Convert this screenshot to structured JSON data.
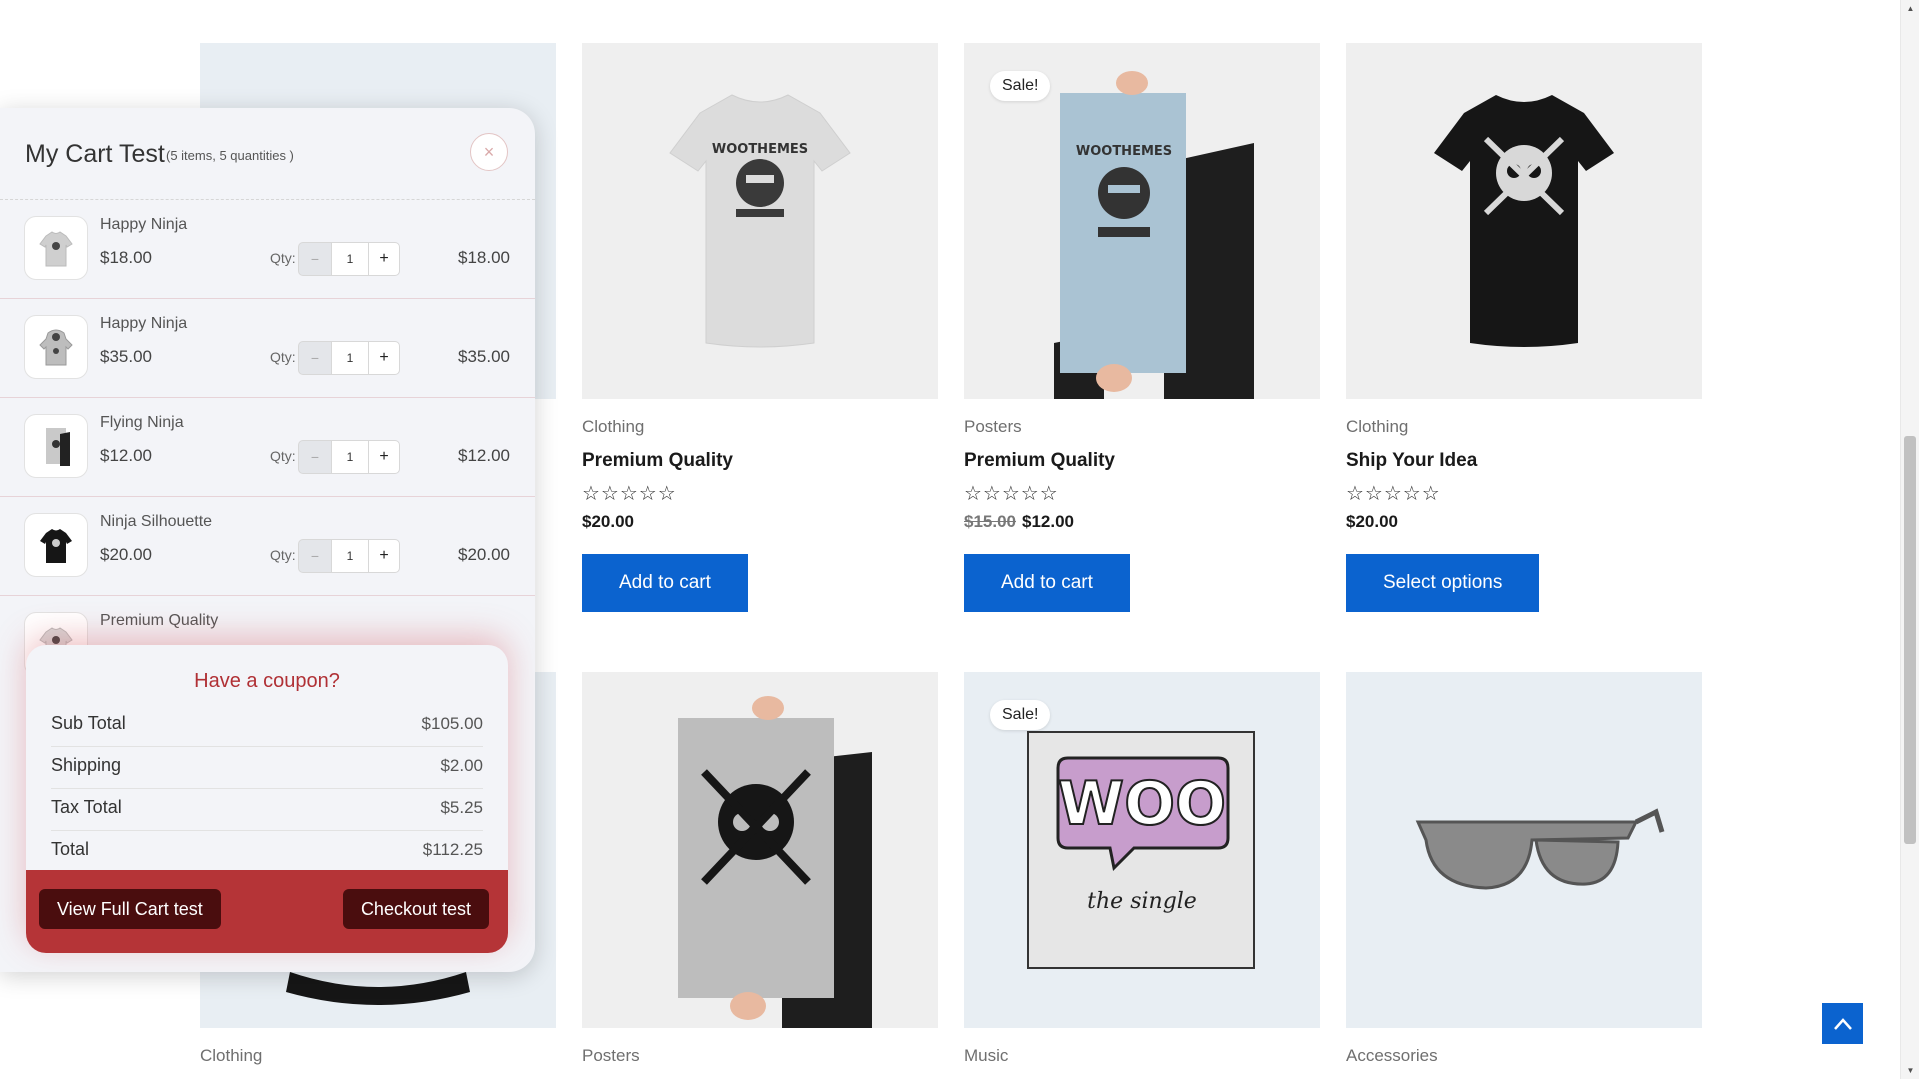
{
  "products_row1": [
    {
      "category": "",
      "title": "",
      "stars": "",
      "price": "",
      "old_price": "",
      "button": "",
      "sale": ""
    },
    {
      "category": "Clothing",
      "title": "Premium Quality",
      "stars": "☆☆☆☆☆",
      "price": "$20.00",
      "old_price": "",
      "button": "Add to cart",
      "sale": ""
    },
    {
      "category": "Posters",
      "title": "Premium Quality",
      "stars": "☆☆☆☆☆",
      "price": "$12.00",
      "old_price": "$15.00",
      "button": "Add to cart",
      "sale": "Sale!"
    },
    {
      "category": "Clothing",
      "title": "Ship Your Idea",
      "stars": "☆☆☆☆☆",
      "price": "$20.00",
      "old_price": "",
      "button": "Select options",
      "sale": ""
    }
  ],
  "products_row2": [
    {
      "category": "Clothing",
      "sale": ""
    },
    {
      "category": "Posters",
      "sale": ""
    },
    {
      "category": "Music",
      "sale": "Sale!",
      "art_line1": "WOO",
      "art_line2": "the single"
    },
    {
      "category": "Accessories",
      "sale": ""
    }
  ],
  "cart": {
    "title": "My Cart Test",
    "subtitle": "(5 items, 5 quantities )",
    "close_icon": "×",
    "qty_label": "Qty:",
    "minus": "−",
    "plus": "+",
    "items": [
      {
        "name": "Happy Ninja",
        "price": "$18.00",
        "qty": "1",
        "total": "$18.00"
      },
      {
        "name": "Happy Ninja",
        "price": "$35.00",
        "qty": "1",
        "total": "$35.00"
      },
      {
        "name": "Flying Ninja",
        "price": "$12.00",
        "qty": "1",
        "total": "$12.00"
      },
      {
        "name": "Ninja Silhouette",
        "price": "$20.00",
        "qty": "1",
        "total": "$20.00"
      },
      {
        "name": "Premium Quality",
        "price": "",
        "qty": "",
        "total": ""
      }
    ],
    "coupon": "Have a coupon?",
    "totals": [
      {
        "label": "Sub Total",
        "value": "$105.00"
      },
      {
        "label": "Shipping",
        "value": "$2.00"
      },
      {
        "label": "Tax Total",
        "value": "$5.25"
      },
      {
        "label": "Total",
        "value": "$112.25"
      }
    ],
    "view_cart": "View Full Cart test",
    "checkout": "Checkout test"
  },
  "colors": {
    "accent_blue": "#0b63cf",
    "cart_red": "#b53437",
    "button_dark": "#4a0d0e"
  }
}
